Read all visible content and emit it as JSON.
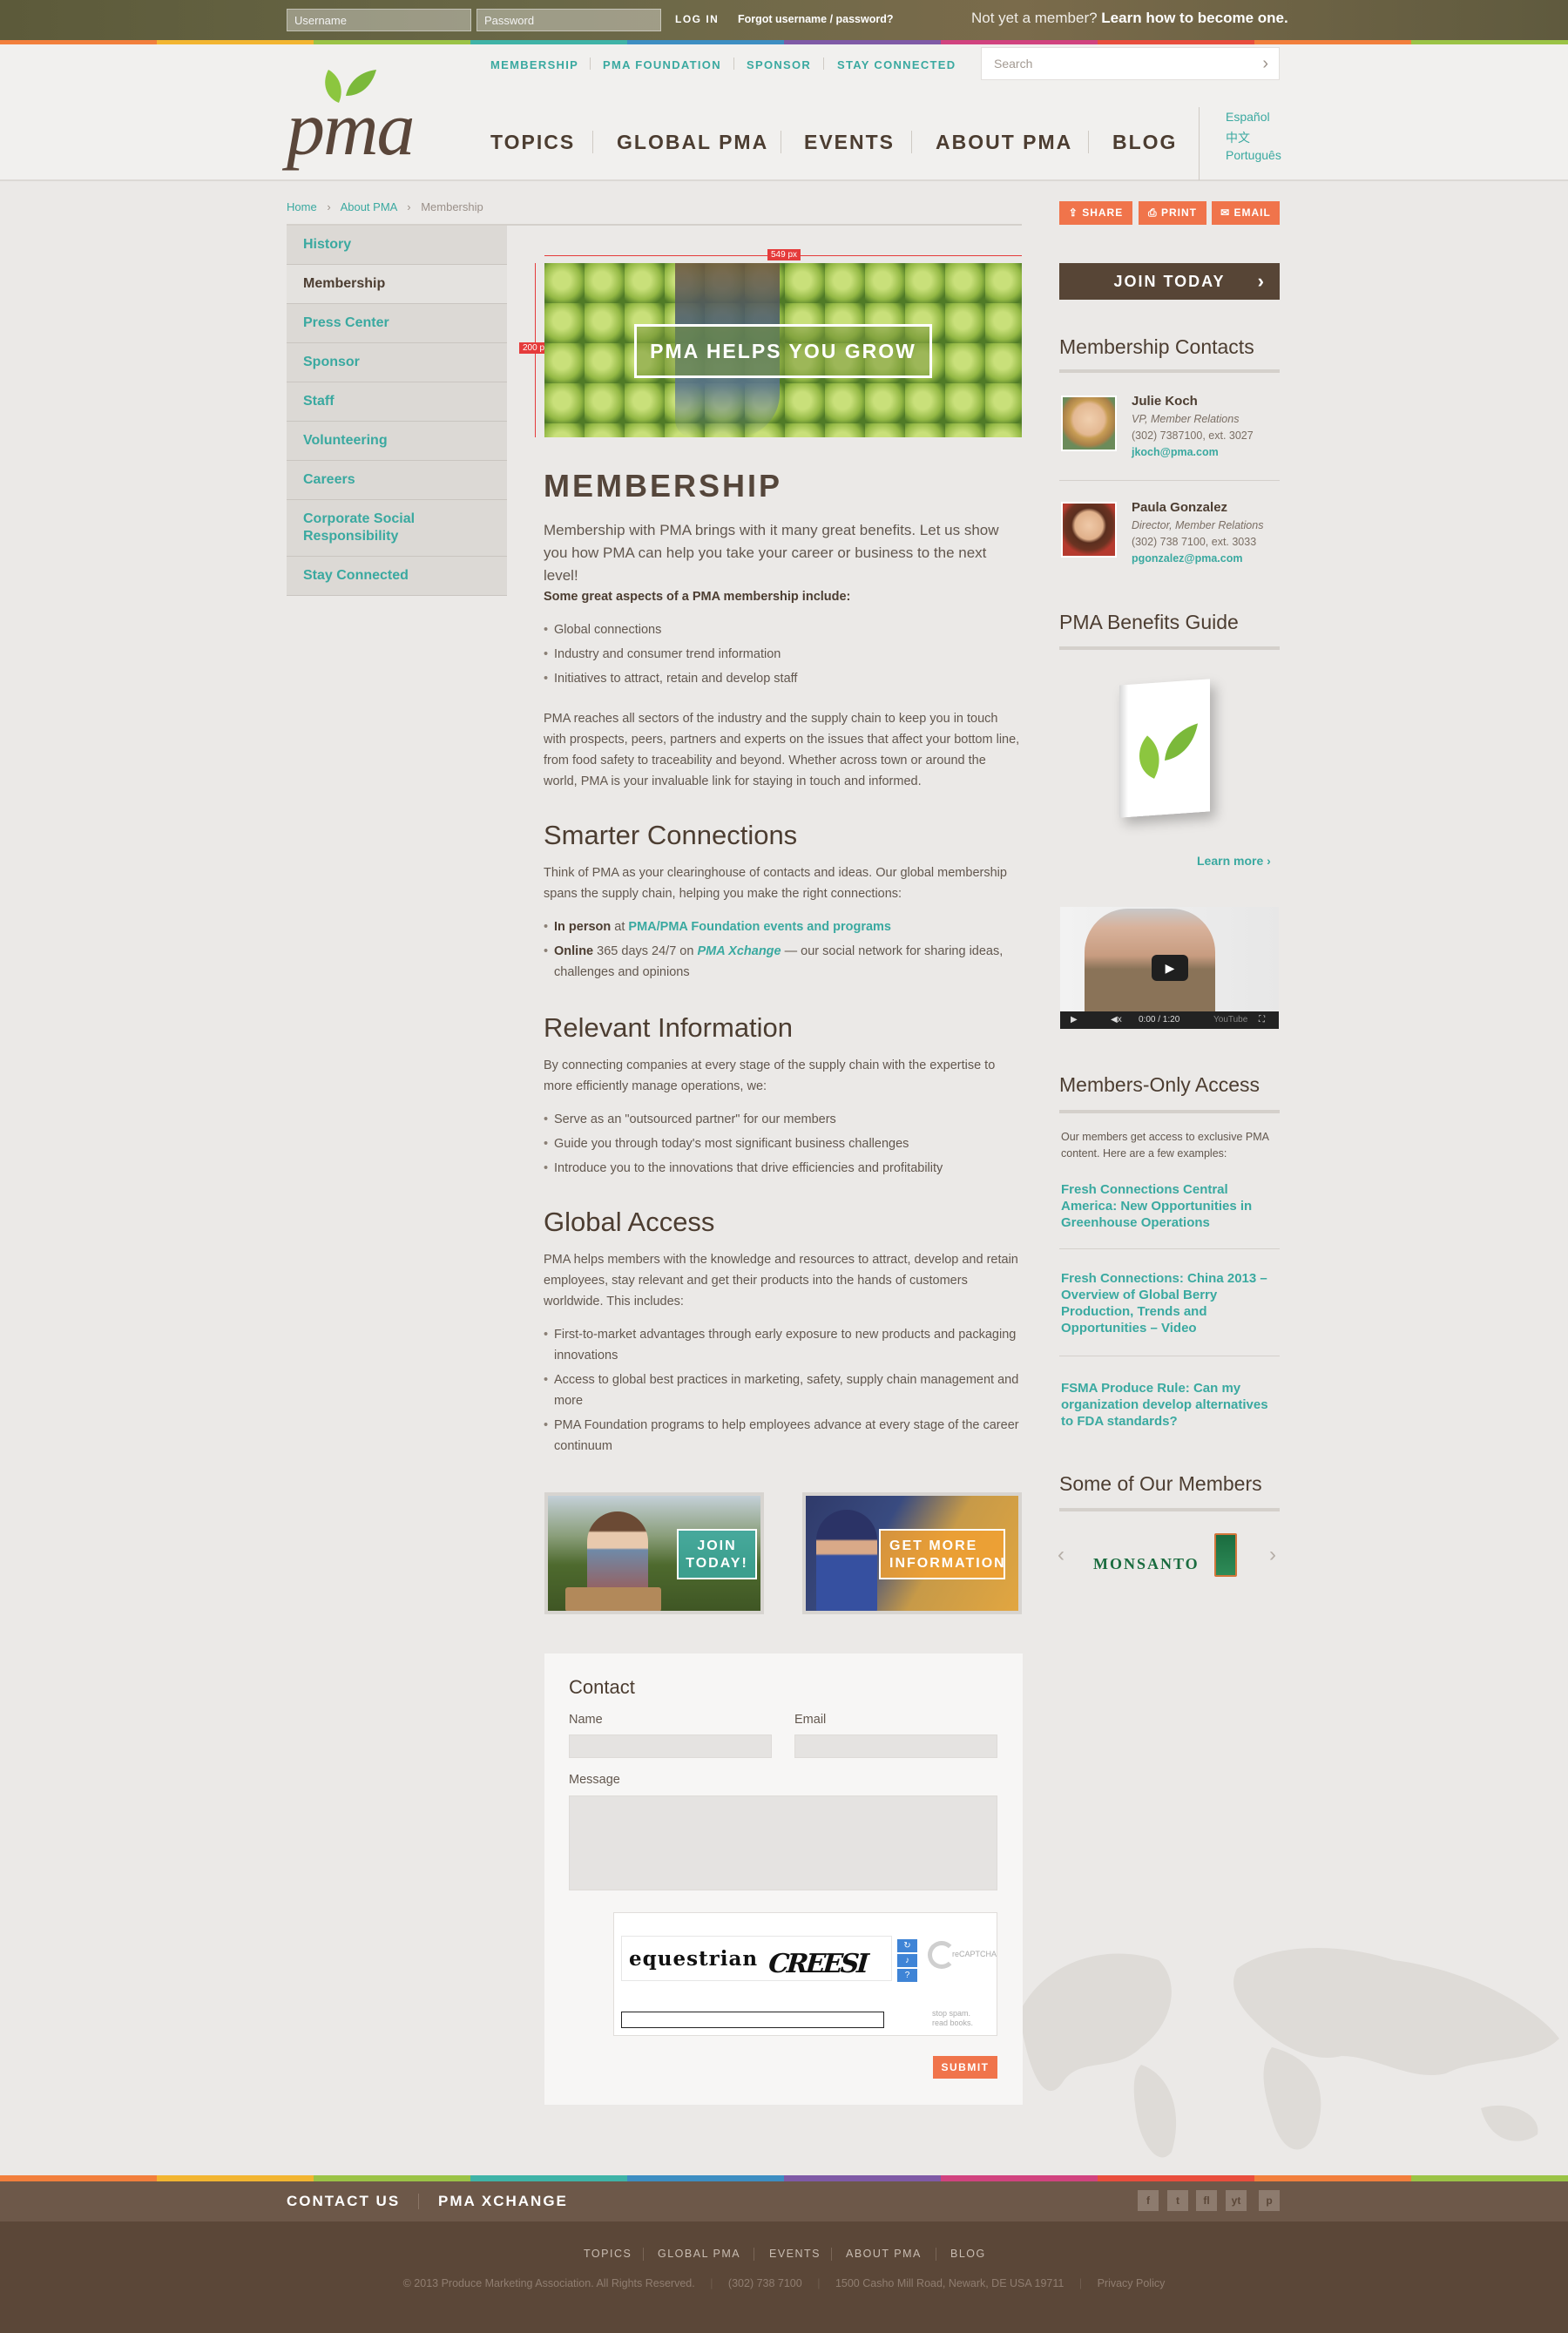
{
  "topbar": {
    "username_ph": "Username",
    "password_ph": "Password",
    "login": "LOG IN",
    "forgot": "Forgot username / password?",
    "member_prefix": "Not yet a member?",
    "member_link": "Learn how to become one."
  },
  "colors": {
    "teal": "#3aa9a0",
    "orange": "#f0744b",
    "brown": "#4c3d31",
    "rainbow": [
      "#f27f3c",
      "#f2b531",
      "#9bc346",
      "#3fb3a7",
      "#3d8ec2",
      "#7f5aa6",
      "#d1437f",
      "#e94e3d"
    ]
  },
  "header": {
    "logo": "pma",
    "util_nav": [
      "MEMBERSHIP",
      "PMA FOUNDATION",
      "SPONSOR",
      "STAY CONNECTED"
    ],
    "search_ph": "Search",
    "main_nav": [
      "TOPICS",
      "GLOBAL PMA",
      "EVENTS",
      "ABOUT PMA",
      "BLOG"
    ],
    "languages": [
      "Español",
      "中文",
      "Português"
    ]
  },
  "breadcrumb": [
    "Home",
    "About PMA",
    "Membership"
  ],
  "sidenav": [
    "History",
    "Membership",
    "Press Center",
    "Sponsor",
    "Staff",
    "Volunteering",
    "Careers",
    "Corporate Social Responsibility",
    "Stay Connected"
  ],
  "hero": {
    "width_label": "549 px",
    "height_label": "200 px",
    "text": "PMA HELPS YOU GROW"
  },
  "main": {
    "title": "MEMBERSHIP",
    "lead": "Membership with PMA brings with it many great benefits. Let us show you how PMA can help you take your career or business to the next level!",
    "aspects_title": "Some great aspects of a PMA membership include:",
    "aspects": [
      "Global connections",
      "Industry and consumer trend information",
      "Initiatives to attract, retain and develop staff"
    ],
    "reach": "PMA reaches all sectors of the industry and the supply chain to keep you in touch with prospects, peers, partners and experts on the issues that affect your bottom line, from food safety to traceability and beyond. Whether across town or around the world, PMA is your invaluable link for staying in touch and informed.",
    "s1_title": "Smarter Connections",
    "s1_text": "Think of PMA as your clearinghouse of contacts and ideas. Our global membership spans the supply chain, helping you make the right connections:",
    "s1_b1_strong": "In person",
    "s1_b1_mid": " at ",
    "s1_b1_link": "PMA/PMA Foundation events and programs",
    "s1_b2_strong": "Online",
    "s1_b2_mid": " 365 days 24/7 on ",
    "s1_b2_link": "PMA Xchange",
    "s1_b2_end": " — our social network for sharing ideas, challenges and opinions",
    "s2_title": "Relevant Information",
    "s2_text": "By connecting companies at every stage of the supply chain with the expertise to more efficiently manage operations, we:",
    "s2_list": [
      "Serve as an \"outsourced partner\" for our members",
      "Guide you through today's most significant business challenges",
      "Introduce you to the innovations that drive efficiencies and profitability"
    ],
    "s3_title": "Global Access",
    "s3_text": "PMA helps members with the knowledge and resources to attract, develop and retain employees, stay relevant and get their products into the hands of customers worldwide. This includes:",
    "s3_list": [
      "First-to-market advantages through early exposure to new products and packaging innovations",
      "Access to global best practices in marketing, safety, supply chain management and more",
      "PMA Foundation programs to help employees advance at every stage of the career continuum"
    ],
    "promo1": "JOIN TODAY!",
    "promo2": "GET MORE INFORMATION"
  },
  "contact": {
    "title": "Contact",
    "name": "Name",
    "email": "Email",
    "message": "Message",
    "captcha_text": "equestrian",
    "captcha_word": "CREESI",
    "recaptcha": "reCAPTCHA",
    "stop": "stop spam.",
    "read": "read books.",
    "submit": "SUBMIT"
  },
  "right": {
    "share": "SHARE",
    "print": "PRINT",
    "email": "EMAIL",
    "join": "JOIN TODAY",
    "contacts_title": "Membership Contacts",
    "contacts": [
      {
        "name": "Julie Koch",
        "role": "VP, Member Relations",
        "phone": "(302) 7387100, ext. 3027",
        "email": "jkoch@pma.com"
      },
      {
        "name": "Paula Gonzalez",
        "role": "Director, Member Relations",
        "phone": "(302) 738 7100, ext. 3033",
        "email": "pgonzalez@pma.com"
      }
    ],
    "guide_title": "PMA Benefits Guide",
    "guide_more": "Learn more ›",
    "video": {
      "time": "0:00 / 1:20",
      "logo": "YouTube"
    },
    "mo_title": "Members-Only Access",
    "mo_text": "Our members get access to exclusive PMA content. Here are a few examples:",
    "mo_links": [
      "Fresh Connections Central America: New Opportunities in Greenhouse Operations",
      "Fresh Connections: China 2013 – Overview of Global Berry Production, Trends and Opportunities – Video",
      "FSMA Produce Rule: Can my organization develop alternatives to FDA standards?"
    ],
    "members_title": "Some of Our Members",
    "member_logo": "MONSANTO"
  },
  "footer": {
    "links": [
      "CONTACT US",
      "PMA XCHANGE"
    ],
    "social": [
      "f",
      "t",
      "fl",
      "yt",
      "p"
    ],
    "nav": [
      "TOPICS",
      "GLOBAL PMA",
      "EVENTS",
      "ABOUT PMA",
      "BLOG"
    ],
    "copyright": "© 2013 Produce Marketing Association. All Rights Reserved.",
    "phone": "(302) 738 7100",
    "address": "1500 Casho Mill Road, Newark, DE USA 19711",
    "privacy": "Privacy Policy"
  }
}
